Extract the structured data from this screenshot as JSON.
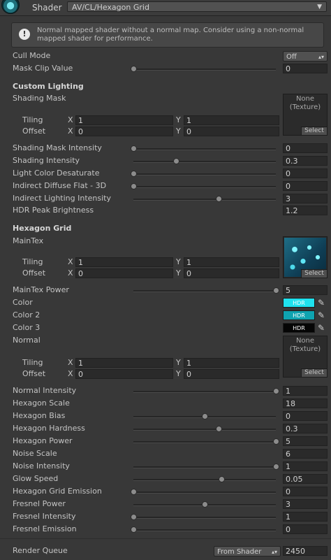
{
  "header": {
    "shader_label": "Shader",
    "shader_value": "AV/CL/Hexagon Grid"
  },
  "warning": {
    "text": "Normal mapped shader without a normal map. Consider using a non-normal mapped shader for performance."
  },
  "cull_mode": {
    "label": "Cull Mode",
    "value": "Off"
  },
  "mask_clip": {
    "label": "Mask Clip Value",
    "value": "0",
    "slider": 0.0
  },
  "custom_lighting": {
    "title": "Custom Lighting",
    "shading_mask": {
      "label": "Shading Mask",
      "none_line1": "None",
      "none_line2": "(Texture)",
      "select": "Select"
    },
    "tiling": {
      "label": "Tiling",
      "x_label": "X",
      "x": "1",
      "y_label": "Y",
      "y": "1"
    },
    "offset": {
      "label": "Offset",
      "x_label": "X",
      "x": "0",
      "y_label": "Y",
      "y": "0"
    },
    "props": [
      {
        "label": "Shading Mask Intensity",
        "value": "0",
        "slider": 0.0
      },
      {
        "label": "Shading Intensity",
        "value": "0.3",
        "slider": 0.3
      },
      {
        "label": "Light Color Desaturate",
        "value": "0",
        "slider": 0.0
      },
      {
        "label": "Indirect Diffuse Flat - 3D",
        "value": "0",
        "slider": 0.0
      },
      {
        "label": "Indirect Lighting Intensity",
        "value": "3",
        "slider": 0.6
      }
    ],
    "hdr_peak": {
      "label": "HDR Peak Brightness",
      "value": "1.2"
    }
  },
  "hexagon_grid": {
    "title": "Hexagon Grid",
    "maintex": {
      "label": "MainTex",
      "select": "Select"
    },
    "tiling": {
      "label": "Tiling",
      "x_label": "X",
      "x": "1",
      "y_label": "Y",
      "y": "1"
    },
    "offset": {
      "label": "Offset",
      "x_label": "X",
      "x": "0",
      "y_label": "Y",
      "y": "0"
    },
    "maintex_power": {
      "label": "MainTex Power",
      "value": "5",
      "slider": 1.0
    },
    "colors": [
      {
        "label": "Color",
        "hdr": "HDR",
        "color": "#1fe2ee"
      },
      {
        "label": "Color 2",
        "hdr": "HDR",
        "color": "#0fa3b0"
      },
      {
        "label": "Color 3",
        "hdr": "HDR",
        "color": "#050505"
      }
    ],
    "normal": {
      "label": "Normal",
      "none_line1": "None",
      "none_line2": "(Texture)",
      "select": "Select"
    },
    "tiling2": {
      "label": "Tiling",
      "x_label": "X",
      "x": "1",
      "y_label": "Y",
      "y": "1"
    },
    "offset2": {
      "label": "Offset",
      "x_label": "X",
      "x": "0",
      "y_label": "Y",
      "y": "0"
    },
    "props": [
      {
        "label": "Normal Intensity",
        "value": "1",
        "slider": 1.0
      },
      {
        "label": "Hexagon Scale",
        "value": "18",
        "slider": null
      },
      {
        "label": "Hexagon Bias",
        "value": "0",
        "slider": 0.5
      },
      {
        "label": "Hexagon Hardness",
        "value": "0.3",
        "slider": 0.6
      },
      {
        "label": "Hexagon Power",
        "value": "5",
        "slider": 1.0
      },
      {
        "label": "Noise Scale",
        "value": "6",
        "slider": null
      },
      {
        "label": "Noise Intensity",
        "value": "1",
        "slider": 1.0
      },
      {
        "label": "Glow Speed",
        "value": "0.05",
        "slider": 0.62
      },
      {
        "label": "Hexagon Grid Emission",
        "value": "0",
        "slider": 0.0
      },
      {
        "label": "Fresnel Power",
        "value": "3",
        "slider": 0.5
      },
      {
        "label": "Fresnel Intensity",
        "value": "1",
        "slider": 0.0
      },
      {
        "label": "Fresnel Emission",
        "value": "0",
        "slider": 0.0
      }
    ]
  },
  "render_queue": {
    "label": "Render Queue",
    "dropdown": "From Shader",
    "value": "2450"
  }
}
